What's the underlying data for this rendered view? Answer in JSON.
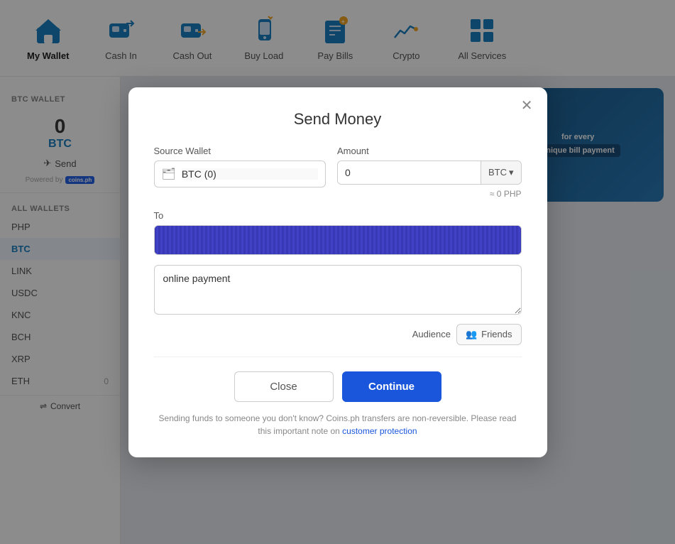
{
  "nav": {
    "items": [
      {
        "id": "my-wallet",
        "label": "My Wallet",
        "icon": "🏠",
        "active": true
      },
      {
        "id": "cash-in",
        "label": "Cash In",
        "icon": "👛",
        "active": false
      },
      {
        "id": "cash-out",
        "label": "Cash Out",
        "icon": "🔄",
        "active": false
      },
      {
        "id": "buy-load",
        "label": "Buy Load",
        "icon": "📱",
        "active": false
      },
      {
        "id": "pay-bills",
        "label": "Pay Bills",
        "icon": "📋",
        "active": false
      },
      {
        "id": "crypto",
        "label": "Crypto",
        "icon": "📈",
        "active": false
      },
      {
        "id": "all-services",
        "label": "All Services",
        "icon": "⊞",
        "active": false
      }
    ]
  },
  "sidebar": {
    "btc_wallet_header": "BTC WALLET",
    "btc_amount": "0",
    "btc_currency": "BTC",
    "send_label": "Send",
    "powered_by": "Powered by",
    "coins_logo": "coins.ph",
    "all_wallets_header": "ALL WALLETS",
    "wallets": [
      {
        "name": "PHP",
        "balance": "",
        "active": false
      },
      {
        "name": "BTC",
        "balance": "",
        "active": true
      },
      {
        "name": "LINK",
        "balance": "",
        "active": false
      },
      {
        "name": "USDC",
        "balance": "",
        "active": false
      },
      {
        "name": "KNC",
        "balance": "",
        "active": false
      },
      {
        "name": "BCH",
        "balance": "",
        "active": false
      },
      {
        "name": "XRP",
        "balance": "",
        "active": false
      },
      {
        "name": "ETH",
        "balance": "0",
        "active": false
      }
    ],
    "convert_label": "Convert"
  },
  "modal": {
    "title": "Send Money",
    "source_wallet_label": "Source Wallet",
    "source_wallet_value": "BTC (0)",
    "amount_label": "Amount",
    "amount_value": "0",
    "currency_select": "BTC",
    "php_equiv": "≈ 0 PHP",
    "to_label": "To",
    "note_placeholder": "online payment",
    "audience_label": "Audience",
    "friends_label": "Friends",
    "close_button": "Close",
    "continue_button": "Continue",
    "warning_text": "Sending funds to someone you don't know? Coins.ph transfers are non-reversible. Please read this important note on",
    "customer_protection_link": "customer protection"
  }
}
